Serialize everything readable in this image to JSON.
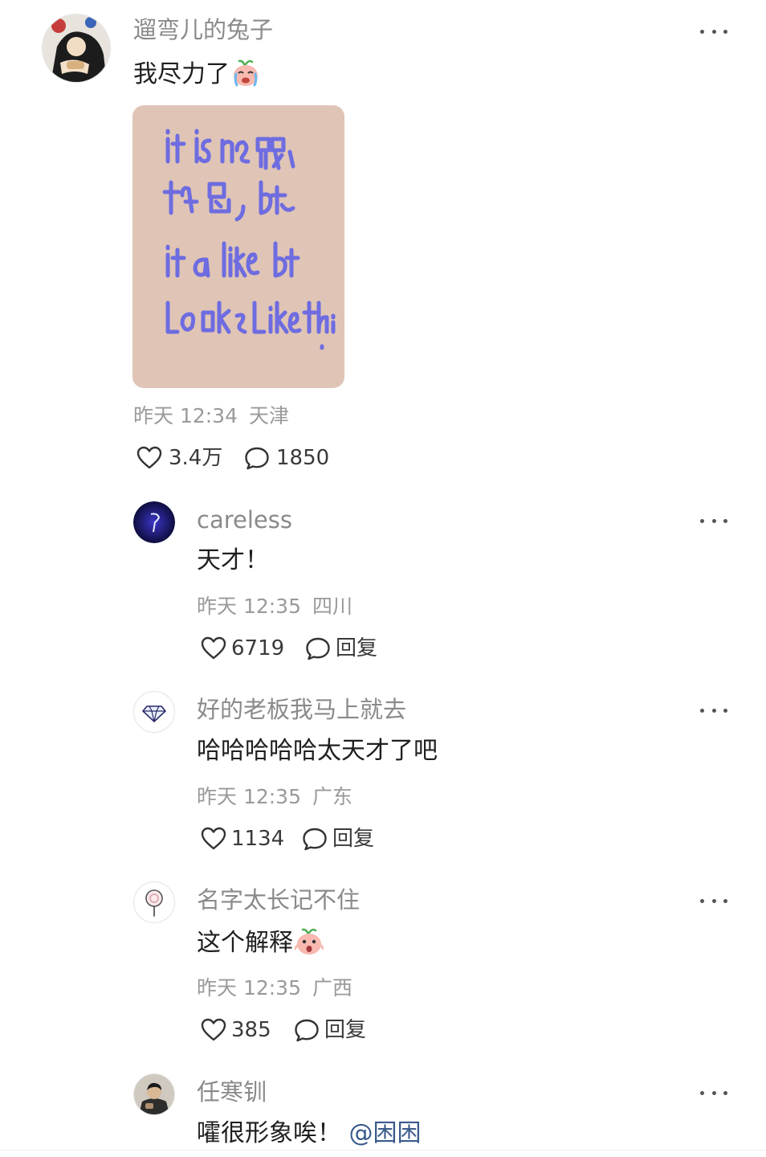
{
  "post": {
    "author": "遛弯儿的兔子",
    "text": "我尽力了",
    "emoji_icon": "crying-peach-emoji",
    "image_alt": "handwritten-note-image",
    "time": "昨天 12:34",
    "location": "天津",
    "likes": "3.4万",
    "comments": "1850"
  },
  "comments": [
    {
      "author": "careless",
      "text": "天才！",
      "time": "昨天 12:35",
      "location": "四川",
      "likes": "6719",
      "reply": "回复",
      "avatar_icon": "lightning-night-avatar"
    },
    {
      "author": "好的老板我马上就去",
      "text": "哈哈哈哈哈太天才了吧",
      "time": "昨天 12:35",
      "location": "广东",
      "likes": "1134",
      "reply": "回复",
      "avatar_icon": "diamond-icon"
    },
    {
      "author": "名字太长记不住",
      "text": "这个解释",
      "time": "昨天 12:35",
      "location": "广西",
      "likes": "385",
      "reply": "回复",
      "avatar_icon": "lollipop-icon",
      "emoji_icon": "shocked-peach-emoji"
    },
    {
      "author": "任寒钏",
      "text": "嚯很形象唉！",
      "mention": "@困困",
      "avatar_icon": "person-photo-avatar"
    }
  ],
  "colors": {
    "name": "#8a8a8a",
    "meta": "#9a9a9a",
    "mention": "#3a5a8c",
    "note_bg": "#e0c5b6",
    "note_ink": "#6e6ce0"
  }
}
